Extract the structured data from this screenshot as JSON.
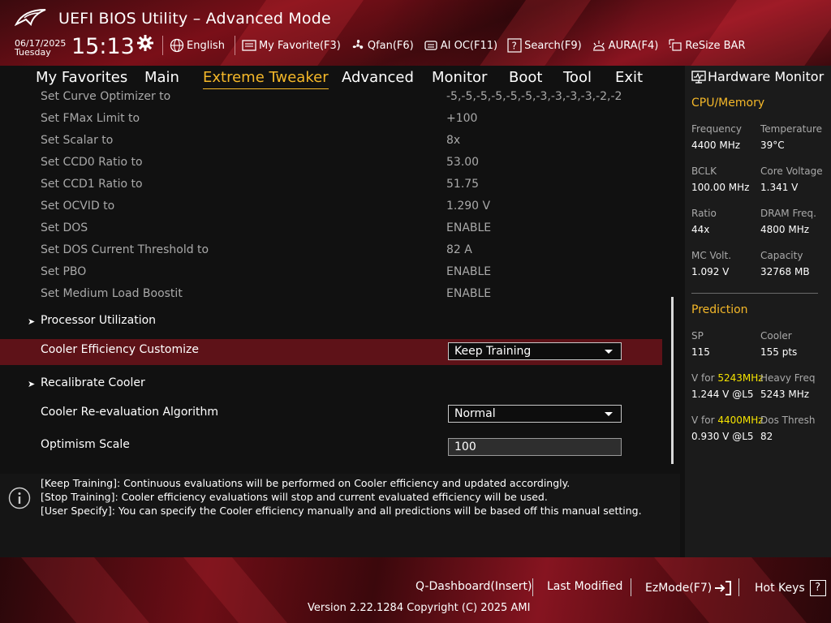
{
  "header": {
    "title": "UEFI BIOS Utility – Advanced Mode",
    "date": "06/17/2025",
    "day": "Tuesday",
    "time": "15:13",
    "toolbar": [
      {
        "label": "English",
        "icon": "globe-icon"
      },
      {
        "label": "My Favorite(F3)",
        "icon": "favorite-icon"
      },
      {
        "label": "Qfan(F6)",
        "icon": "fan-icon"
      },
      {
        "label": "AI OC(F11)",
        "icon": "ai-oc-icon"
      },
      {
        "label": "Search(F9)",
        "icon": "search-icon"
      },
      {
        "label": "AURA(F4)",
        "icon": "aura-icon"
      },
      {
        "label": "ReSize BAR",
        "icon": "resize-bar-icon"
      }
    ]
  },
  "tabs": [
    {
      "label": "My Favorites"
    },
    {
      "label": "Main"
    },
    {
      "label": "Extreme Tweaker",
      "active": true
    },
    {
      "label": "Advanced"
    },
    {
      "label": "Monitor"
    },
    {
      "label": "Boot"
    },
    {
      "label": "Tool"
    },
    {
      "label": "Exit"
    }
  ],
  "settings": [
    {
      "label": "Set Curve Optimizer to",
      "value": "-5,-5,-5,-5,-5,-5,-3,-3,-3,-3,-2,-2"
    },
    {
      "label": "Set FMax Limit to",
      "value": "+100"
    },
    {
      "label": "Set Scalar to",
      "value": "8x"
    },
    {
      "label": "Set CCD0 Ratio to",
      "value": "53.00"
    },
    {
      "label": "Set CCD1 Ratio to",
      "value": "51.75"
    },
    {
      "label": "Set OCVID to",
      "value": "1.290 V"
    },
    {
      "label": "Set DOS",
      "value": "ENABLE"
    },
    {
      "label": "Set DOS Current Threshold to",
      "value": "82 A"
    },
    {
      "label": "Set PBO",
      "value": "ENABLE"
    },
    {
      "label": "Set Medium Load Boostit",
      "value": "ENABLE"
    }
  ],
  "options": {
    "processor_utilization": "Processor Utilization",
    "cooler_efficiency_label": "Cooler Efficiency Customize",
    "cooler_efficiency_value": "Keep Training",
    "recalibrate_cooler": "Recalibrate Cooler",
    "reevaluation_label": "Cooler Re-evaluation Algorithm",
    "reevaluation_value": "Normal",
    "optimism_label": "Optimism Scale",
    "optimism_value": "100"
  },
  "help": [
    "[Keep Training]: Continuous evaluations will be performed on Cooler efficiency and updated accordingly.",
    "[Stop Training]: Cooler efficiency evaluations will stop and current evaluated efficiency will be used.",
    "[User Specify]: You can specify the Cooler efficiency manually and all predictions will be based off this manual setting."
  ],
  "hardware_monitor": {
    "title": "Hardware Monitor",
    "cpu_memory": {
      "heading": "CPU/Memory",
      "items": [
        {
          "label": "Frequency",
          "value": "4400 MHz"
        },
        {
          "label": "Temperature",
          "value": "39°C"
        },
        {
          "label": "BCLK",
          "value": "100.00 MHz"
        },
        {
          "label": "Core Voltage",
          "value": "1.341 V"
        },
        {
          "label": "Ratio",
          "value": "44x"
        },
        {
          "label": "DRAM Freq.",
          "value": "4800 MHz"
        },
        {
          "label": "MC Volt.",
          "value": "1.092 V"
        },
        {
          "label": "Capacity",
          "value": "32768 MB"
        }
      ]
    },
    "prediction": {
      "heading": "Prediction",
      "sp_label": "SP",
      "sp_value": "115",
      "cooler_label": "Cooler",
      "cooler_value": "155 pts",
      "v1_prefix": "V for ",
      "v1_freq": "5243MHz",
      "v1_value": "1.244 V @L5",
      "heavy_label": "Heavy Freq",
      "heavy_value": "5243 MHz",
      "v2_prefix": "V for ",
      "v2_freq": "4400MHz",
      "v2_value": "0.930 V @L5",
      "dos_label": "Dos Thresh",
      "dos_value": "82"
    }
  },
  "footer": {
    "q_dashboard": "Q-Dashboard(Insert)",
    "last_modified": "Last Modified",
    "ez_mode": "EzMode(F7)",
    "hot_keys": "Hot Keys",
    "hot_keys_glyph": "?",
    "version": "Version 2.22.1284 Copyright (C) 2025 AMI"
  },
  "colors": {
    "accent": "#f5b829",
    "highlight_row": "#5e1218",
    "prediction_freq": "#f5e300"
  }
}
